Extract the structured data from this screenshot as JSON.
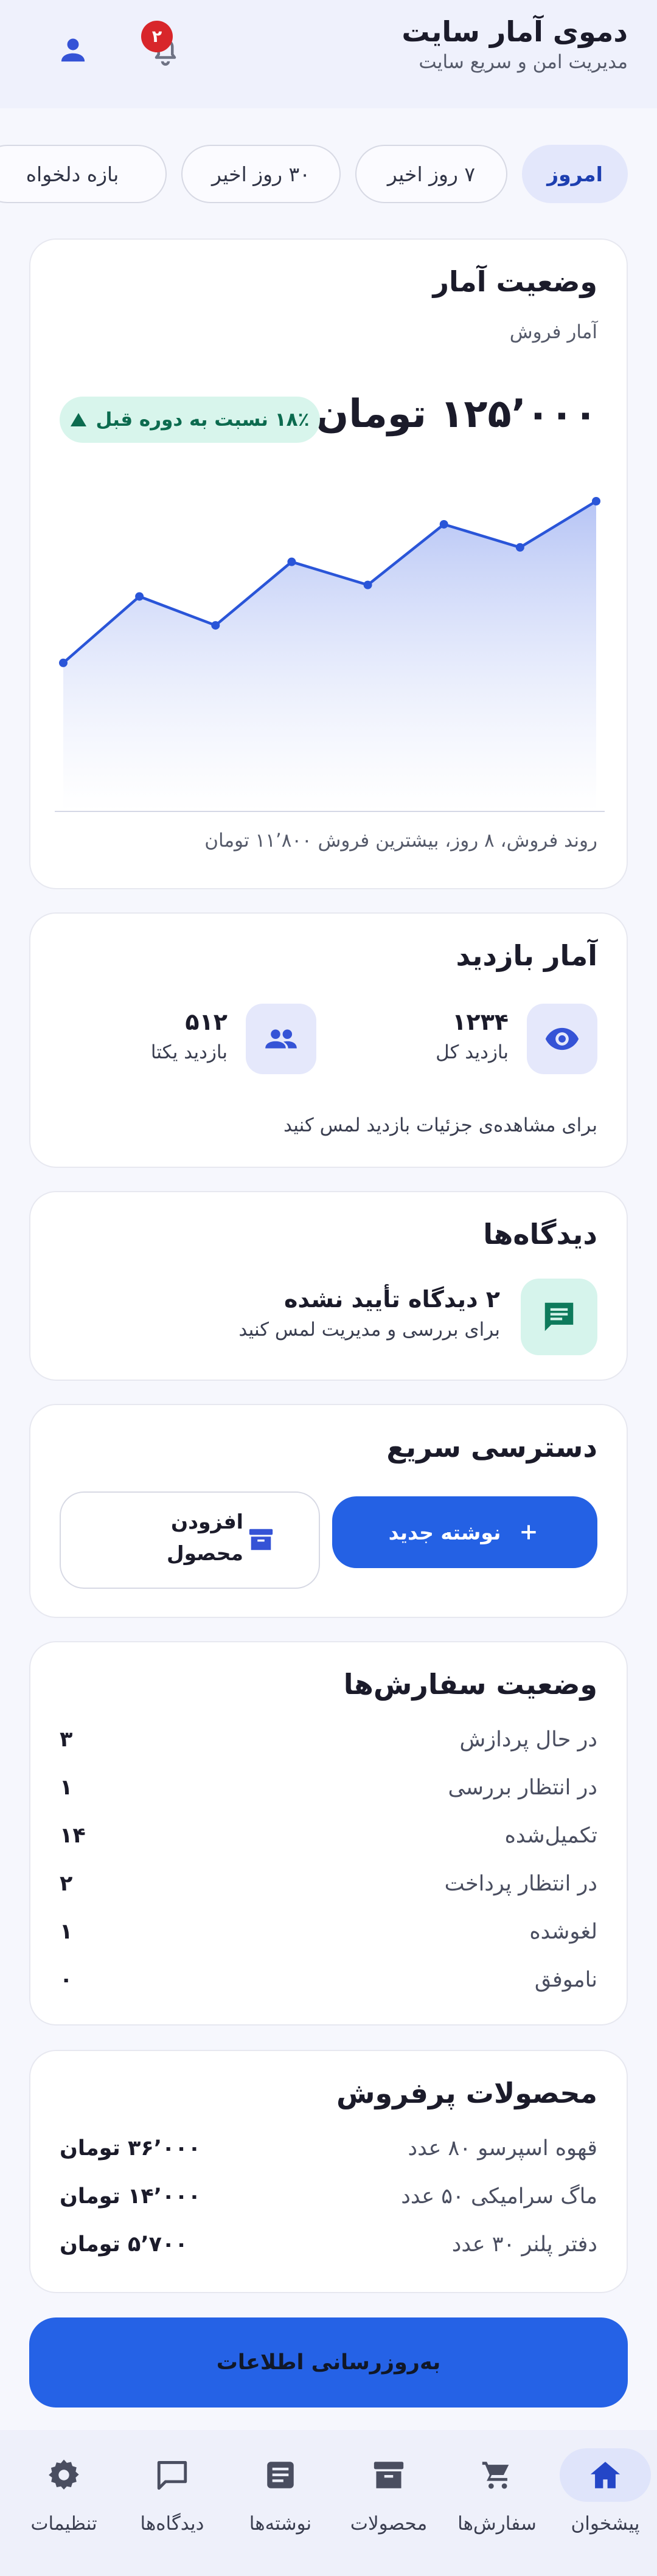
{
  "header": {
    "title": "دموی آمار سایت",
    "subtitle": "مدیریت امن و سریع سایت",
    "notification_count": "۲",
    "notification_icon": "bell-icon",
    "profile_icon": "person-icon"
  },
  "period_chips": [
    {
      "label": "امروز",
      "active": true
    },
    {
      "label": "۷ روز اخیر",
      "active": false
    },
    {
      "label": "۳۰ روز اخیر",
      "active": false
    },
    {
      "label": "بازه دلخواه",
      "active": false
    }
  ],
  "sales": {
    "title": "وضعیت آمار",
    "subtitle": "آمار فروش",
    "value": "۱۲۵٬۰۰۰ تومان",
    "trend": "۱۸٪ نسبت به دوره قبل",
    "caption": "روند فروش، ۸ روز، بیشترین فروش ۱۱٬۸۰۰ تومان"
  },
  "chart_data": {
    "type": "area",
    "title": "",
    "xlabel": "",
    "ylabel": "",
    "x": [
      1,
      2,
      3,
      4,
      5,
      6,
      7,
      8
    ],
    "values": [
      6200,
      8500,
      7500,
      9700,
      8900,
      11000,
      10200,
      11800
    ],
    "ylim": [
      0,
      11800
    ],
    "grid": false,
    "accent": "#2a55d8"
  },
  "visits": {
    "title": "آمار بازدید",
    "total_value": "۱۲۳۴",
    "total_label": "بازدید کل",
    "unique_value": "۵۱۲",
    "unique_label": "بازدید یکتا",
    "hint": "برای مشاهده‌ی جزئیات بازدید لمس کنید"
  },
  "comments": {
    "title": "دیدگاه‌ها",
    "pending": "۲ دیدگاه تأیید نشده",
    "hint": "برای بررسی و مدیریت لمس کنید"
  },
  "quick_access": {
    "title": "دسترسی سریع",
    "new_post": "نوشته جدید",
    "add_product": "افزودن محصول"
  },
  "orders": {
    "title": "وضعیت سفارش‌ها",
    "rows": [
      {
        "label": "در حال پردازش",
        "value": "۳"
      },
      {
        "label": "در انتظار بررسی",
        "value": "۱"
      },
      {
        "label": "تکمیل‌شده",
        "value": "۱۴"
      },
      {
        "label": "در انتظار پرداخت",
        "value": "۲"
      },
      {
        "label": "لغوشده",
        "value": "۱"
      },
      {
        "label": "ناموفق",
        "value": "۰"
      }
    ]
  },
  "best_sellers": {
    "title": "محصولات پرفروش",
    "rows": [
      {
        "label": "قهوه اسپرسو ۸۰ عدد",
        "value": "۳۶٬۰۰۰ تومان"
      },
      {
        "label": "ماگ سرامیکی ۵۰ عدد",
        "value": "۱۴٬۰۰۰ تومان"
      },
      {
        "label": "دفتر پلنر ۳۰ عدد",
        "value": "۵٬۷۰۰ تومان"
      }
    ]
  },
  "update_label": "به‌روزرسانی اطلاعات",
  "nav": [
    {
      "label": "پیشخوان",
      "icon": "home-icon",
      "active": true
    },
    {
      "label": "سفارش‌ها",
      "icon": "cart-icon",
      "active": false
    },
    {
      "label": "محصولات",
      "icon": "archive-box-icon",
      "active": false
    },
    {
      "label": "نوشته‌ها",
      "icon": "article-icon",
      "active": false
    },
    {
      "label": "دیدگاه‌ها",
      "icon": "chat-bubble-icon",
      "active": false
    },
    {
      "label": "تنظیمات",
      "icon": "gear-icon",
      "active": false
    }
  ],
  "colors": {
    "primary": "#2461e4",
    "badge_red": "#d8262a",
    "trend_bg": "#d8f5ec",
    "trend_text": "#0c6b4f"
  }
}
